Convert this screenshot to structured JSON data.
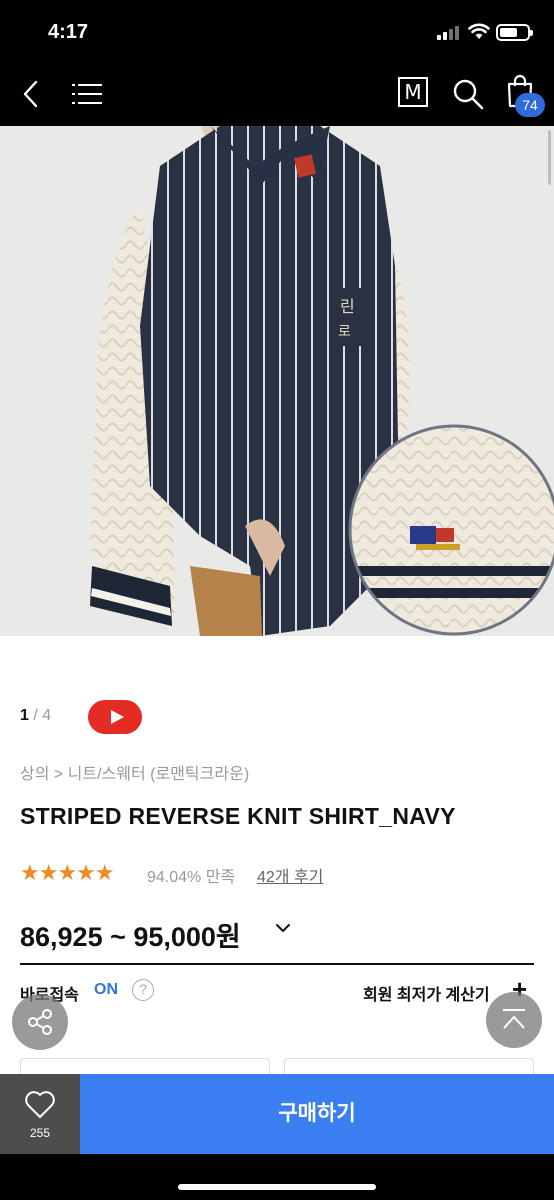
{
  "status_bar": {
    "time": "4:17"
  },
  "nav": {
    "cart_count": "74",
    "menu_m_label": "M"
  },
  "product": {
    "image_counter": {
      "current": "1",
      "separator": "/",
      "total": "4"
    },
    "breadcrumb": "상의 > 니트/스웨터 (로맨틱크라운)",
    "title": "STRIPED REVERSE KNIT SHIRT_NAVY",
    "rating_stars": "★★★★★",
    "rating_value": 4.7,
    "satisfaction": "94.04% 만족",
    "review_link": "42개 후기",
    "price": "86,925 ~ 95,000원"
  },
  "purchase_options": {
    "direct_access_label": "바로접속",
    "direct_access_state": "ON",
    "help_symbol": "?",
    "member_price_calc": "회원 최저가 계산기",
    "plus_symbol": "+"
  },
  "bottom_bar": {
    "like_count": "255",
    "buy_label": "구매하기"
  },
  "colors": {
    "accent_blue": "#3a7ef2",
    "badge_blue": "#2e6bdb",
    "star_orange": "#f08a24",
    "youtube_red": "#e42b24",
    "on_blue": "#2f77d6"
  }
}
